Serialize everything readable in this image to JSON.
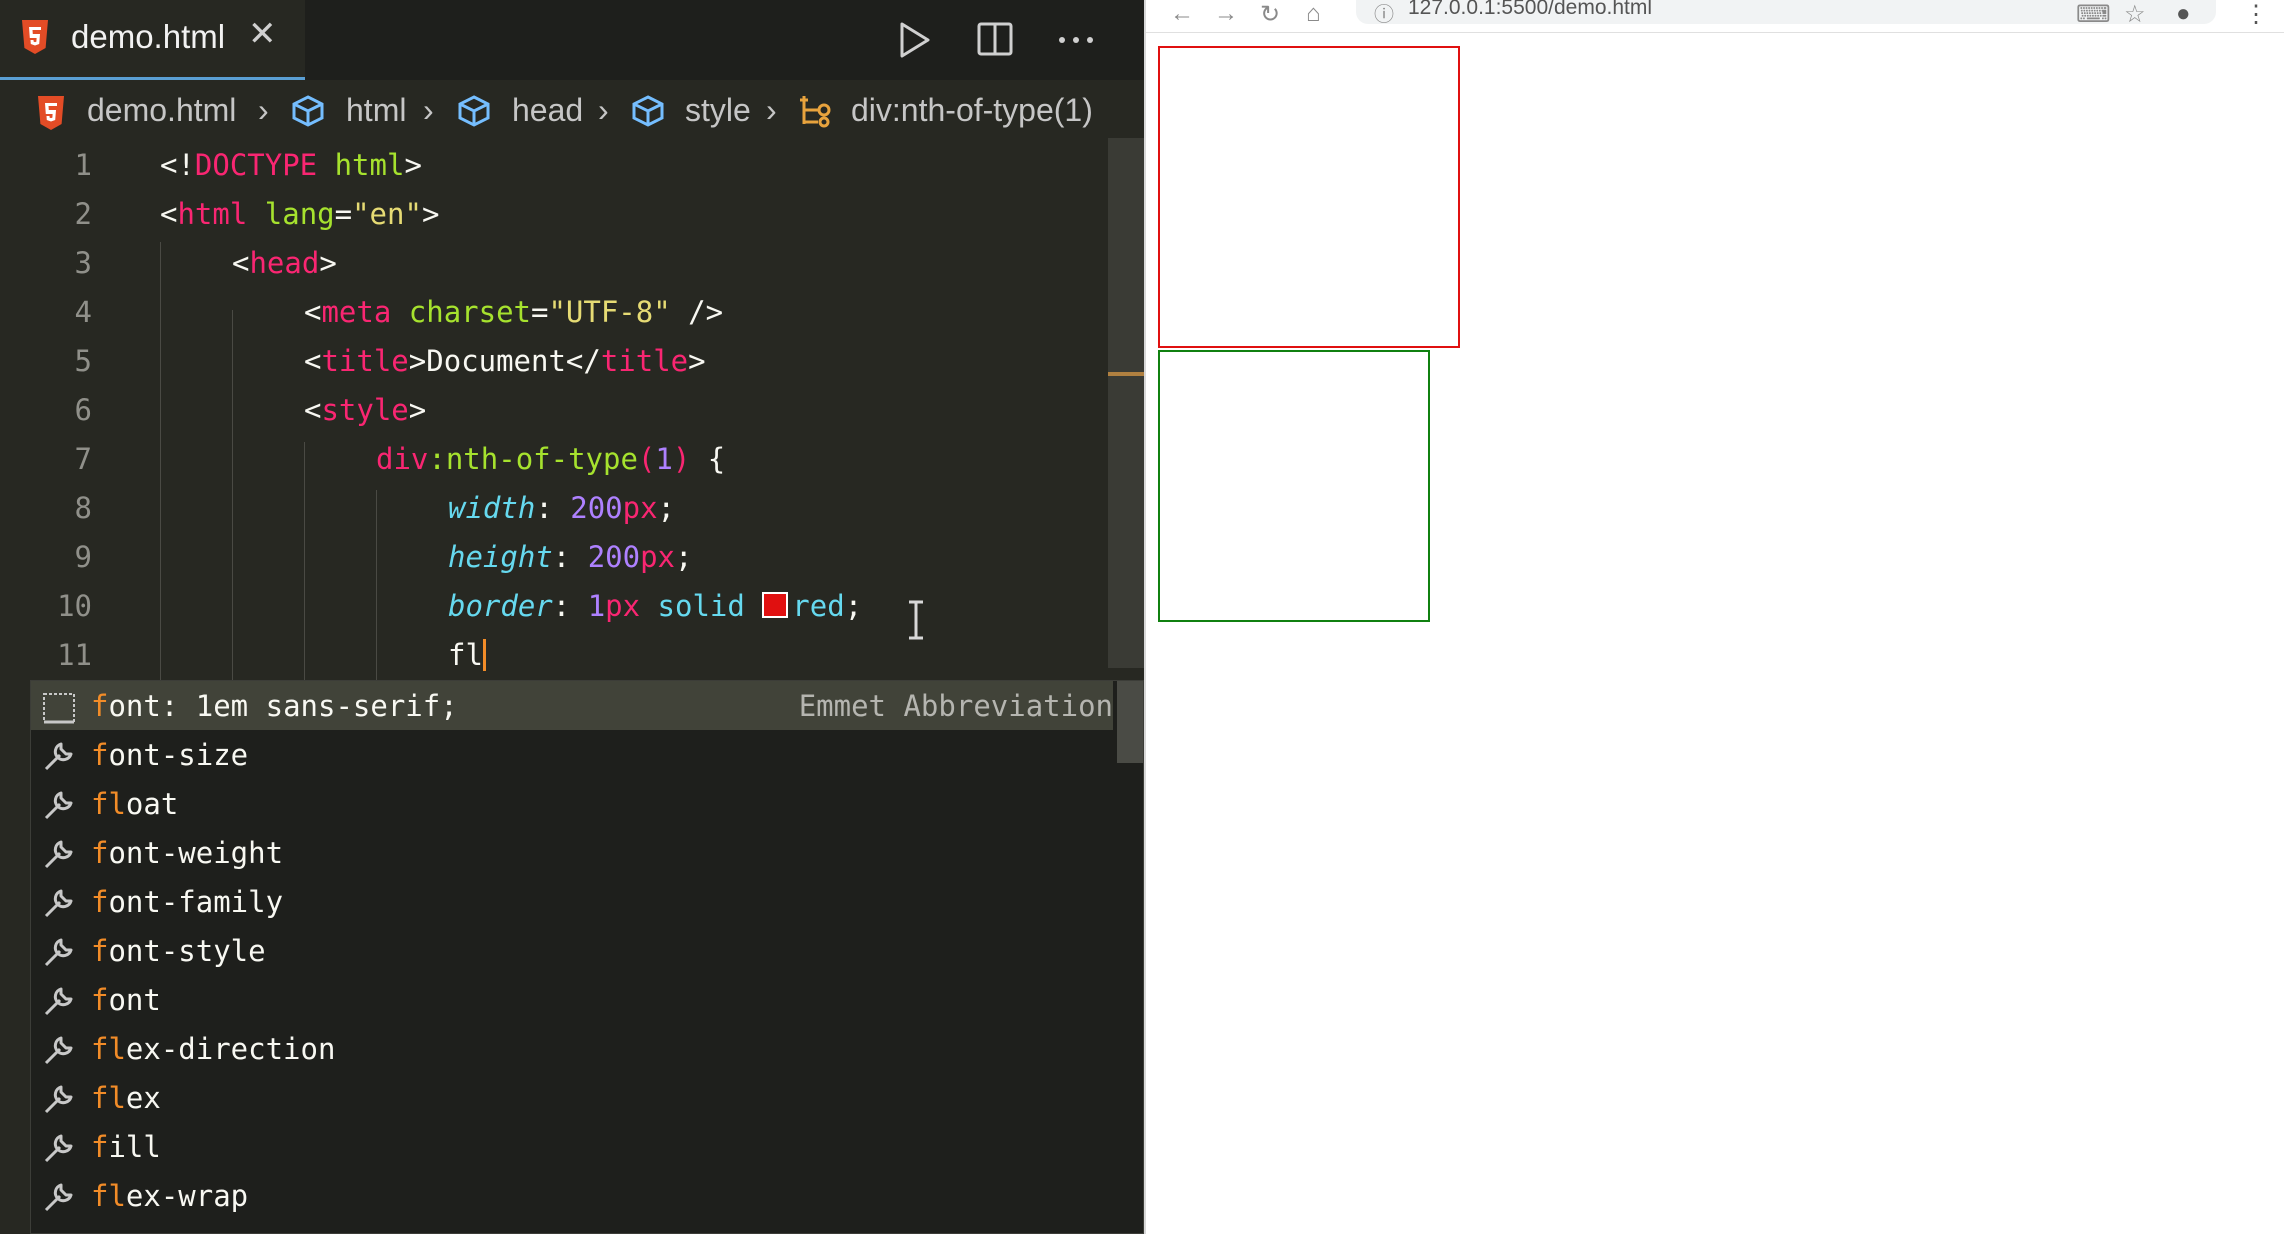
{
  "editor": {
    "tab": {
      "label": "demo.html",
      "close": "✕"
    },
    "breadcrumb": [
      "demo.html",
      "html",
      "head",
      "style",
      "div:nth-of-type(1)"
    ],
    "lines": [
      {
        "n": "1"
      },
      {
        "n": "2"
      },
      {
        "n": "3"
      },
      {
        "n": "4"
      },
      {
        "n": "5"
      },
      {
        "n": "6"
      },
      {
        "n": "7"
      },
      {
        "n": "8"
      },
      {
        "n": "9"
      },
      {
        "n": "10"
      },
      {
        "n": "11"
      }
    ],
    "code": {
      "l1": {
        "a": "<!",
        "b": "DOCTYPE",
        "c": " html",
        "d": ">"
      },
      "l2": {
        "a": "<",
        "b": "html",
        "c": " lang",
        "d": "=",
        "e": "\"en\"",
        "f": ">"
      },
      "l3": {
        "a": "<",
        "b": "head",
        "c": ">"
      },
      "l4": {
        "a": "<",
        "b": "meta",
        "c": " charset",
        "d": "=",
        "e": "\"UTF-8\"",
        "f": " />"
      },
      "l5": {
        "a": "<",
        "b": "title",
        "c": ">Document</",
        "d": "title",
        "e": ">"
      },
      "l6": {
        "a": "<",
        "b": "style",
        "c": ">"
      },
      "l7": {
        "a": "div",
        "b": ":nth-of-type",
        "c": "(",
        "d": "1",
        "e": ")",
        "f": " {"
      },
      "l8": {
        "a": "width",
        "b": ": ",
        "c": "200",
        "d": "px",
        "e": ";"
      },
      "l9": {
        "a": "height",
        "b": ": ",
        "c": "200",
        "d": "px",
        "e": ";"
      },
      "l10": {
        "a": "border",
        "b": ": ",
        "c": "1",
        "d": "px",
        "e": " solid ",
        "f": "red",
        "g": ";"
      },
      "l11": {
        "a": "fl"
      }
    },
    "swatch_color": "#e01010"
  },
  "suggest": {
    "items": [
      {
        "h": "f",
        "rest": "ont: 1em sans-serif;",
        "detail": "Emmet Abbreviation",
        "icon": "emmet-icon"
      },
      {
        "h": "f",
        "rest": "ont-size",
        "icon": "wrench-icon"
      },
      {
        "h": "fl",
        "rest": "oat",
        "icon": "wrench-icon"
      },
      {
        "h": "f",
        "rest": "ont-weight",
        "icon": "wrench-icon"
      },
      {
        "h": "f",
        "rest": "ont-family",
        "icon": "wrench-icon"
      },
      {
        "h": "f",
        "rest": "ont-style",
        "icon": "wrench-icon"
      },
      {
        "h": "f",
        "rest": "ont",
        "icon": "wrench-icon"
      },
      {
        "h": "fl",
        "rest": "ex-direction",
        "icon": "wrench-icon"
      },
      {
        "h": "fl",
        "rest": "ex",
        "icon": "wrench-icon"
      },
      {
        "h": "f",
        "rest": "ill",
        "icon": "wrench-icon"
      },
      {
        "h": "fl",
        "rest": "ex-wrap",
        "icon": "wrench-icon"
      }
    ]
  },
  "browser": {
    "url": "127.0.0.1:5500/demo.html",
    "box1_color": "#e01010",
    "box2_color": "#108010"
  }
}
